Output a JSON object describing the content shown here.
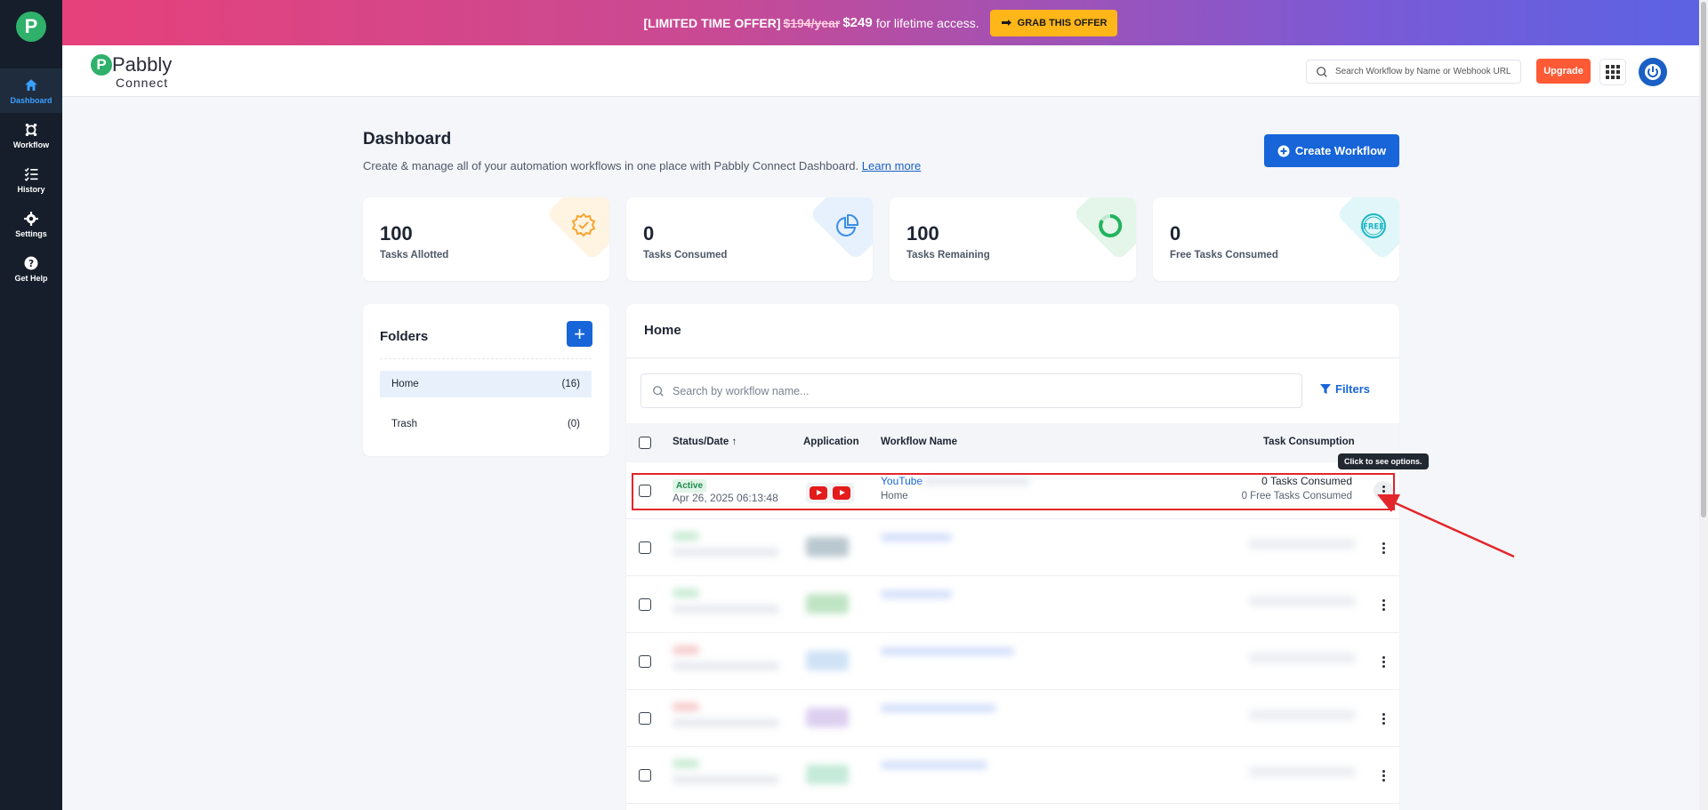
{
  "promo": {
    "prefix": "[LIMITED TIME OFFER]",
    "old_price": "$194/year",
    "new_price": "$249",
    "suffix": "for lifetime access.",
    "cta": "GRAB THIS OFFER"
  },
  "sidebar": {
    "items": [
      {
        "label": "Dashboard",
        "icon": "home-icon",
        "active": true
      },
      {
        "label": "Workflow",
        "icon": "workflow-icon"
      },
      {
        "label": "History",
        "icon": "history-icon"
      },
      {
        "label": "Settings",
        "icon": "gear-icon"
      },
      {
        "label": "Get Help",
        "icon": "help-icon"
      }
    ]
  },
  "header": {
    "brand_name": "Pabbly",
    "brand_sub": "Connect",
    "search_placeholder": "Search Workflow by Name or Webhook URL",
    "upgrade_label": "Upgrade"
  },
  "page": {
    "title": "Dashboard",
    "subtitle": "Create & manage all of your automation workflows in one place with Pabbly Connect Dashboard.",
    "learn_more": "Learn more",
    "create_label": "Create Workflow"
  },
  "stats": [
    {
      "value": "100",
      "label": "Tasks Allotted",
      "color": "#f7a531"
    },
    {
      "value": "0",
      "label": "Tasks Consumed",
      "color": "#3c8ee6"
    },
    {
      "value": "100",
      "label": "Tasks Remaining",
      "color": "#22b35e"
    },
    {
      "value": "0",
      "label": "Free Tasks Consumed",
      "color": "#1cb6c4"
    }
  ],
  "folders": {
    "title": "Folders",
    "items": [
      {
        "name": "Home",
        "count": "(16)",
        "active": true
      },
      {
        "name": "Trash",
        "count": "(0)"
      }
    ]
  },
  "workflows": {
    "title": "Home",
    "search_placeholder": "Search by workflow name...",
    "filters_label": "Filters",
    "columns": {
      "status_date": "Status/Date",
      "application": "Application",
      "workflow_name": "Workflow Name",
      "task_consumption": "Task Consumption"
    },
    "rows": [
      {
        "status": "Active",
        "date": "Apr 26, 2025 06:13:48",
        "apps": [
          "youtube-icon",
          "youtube-icon"
        ],
        "name": "YouTube",
        "folder": "Home",
        "tasks": "0 Tasks Consumed",
        "free_tasks": "0 Free Tasks Consumed"
      }
    ]
  },
  "tooltip": "Click to see options.",
  "colors": {
    "primary": "#1765d8",
    "sidebar": "#161e2b",
    "upgrade": "#ff5a36",
    "highlight": "#e3262b"
  }
}
